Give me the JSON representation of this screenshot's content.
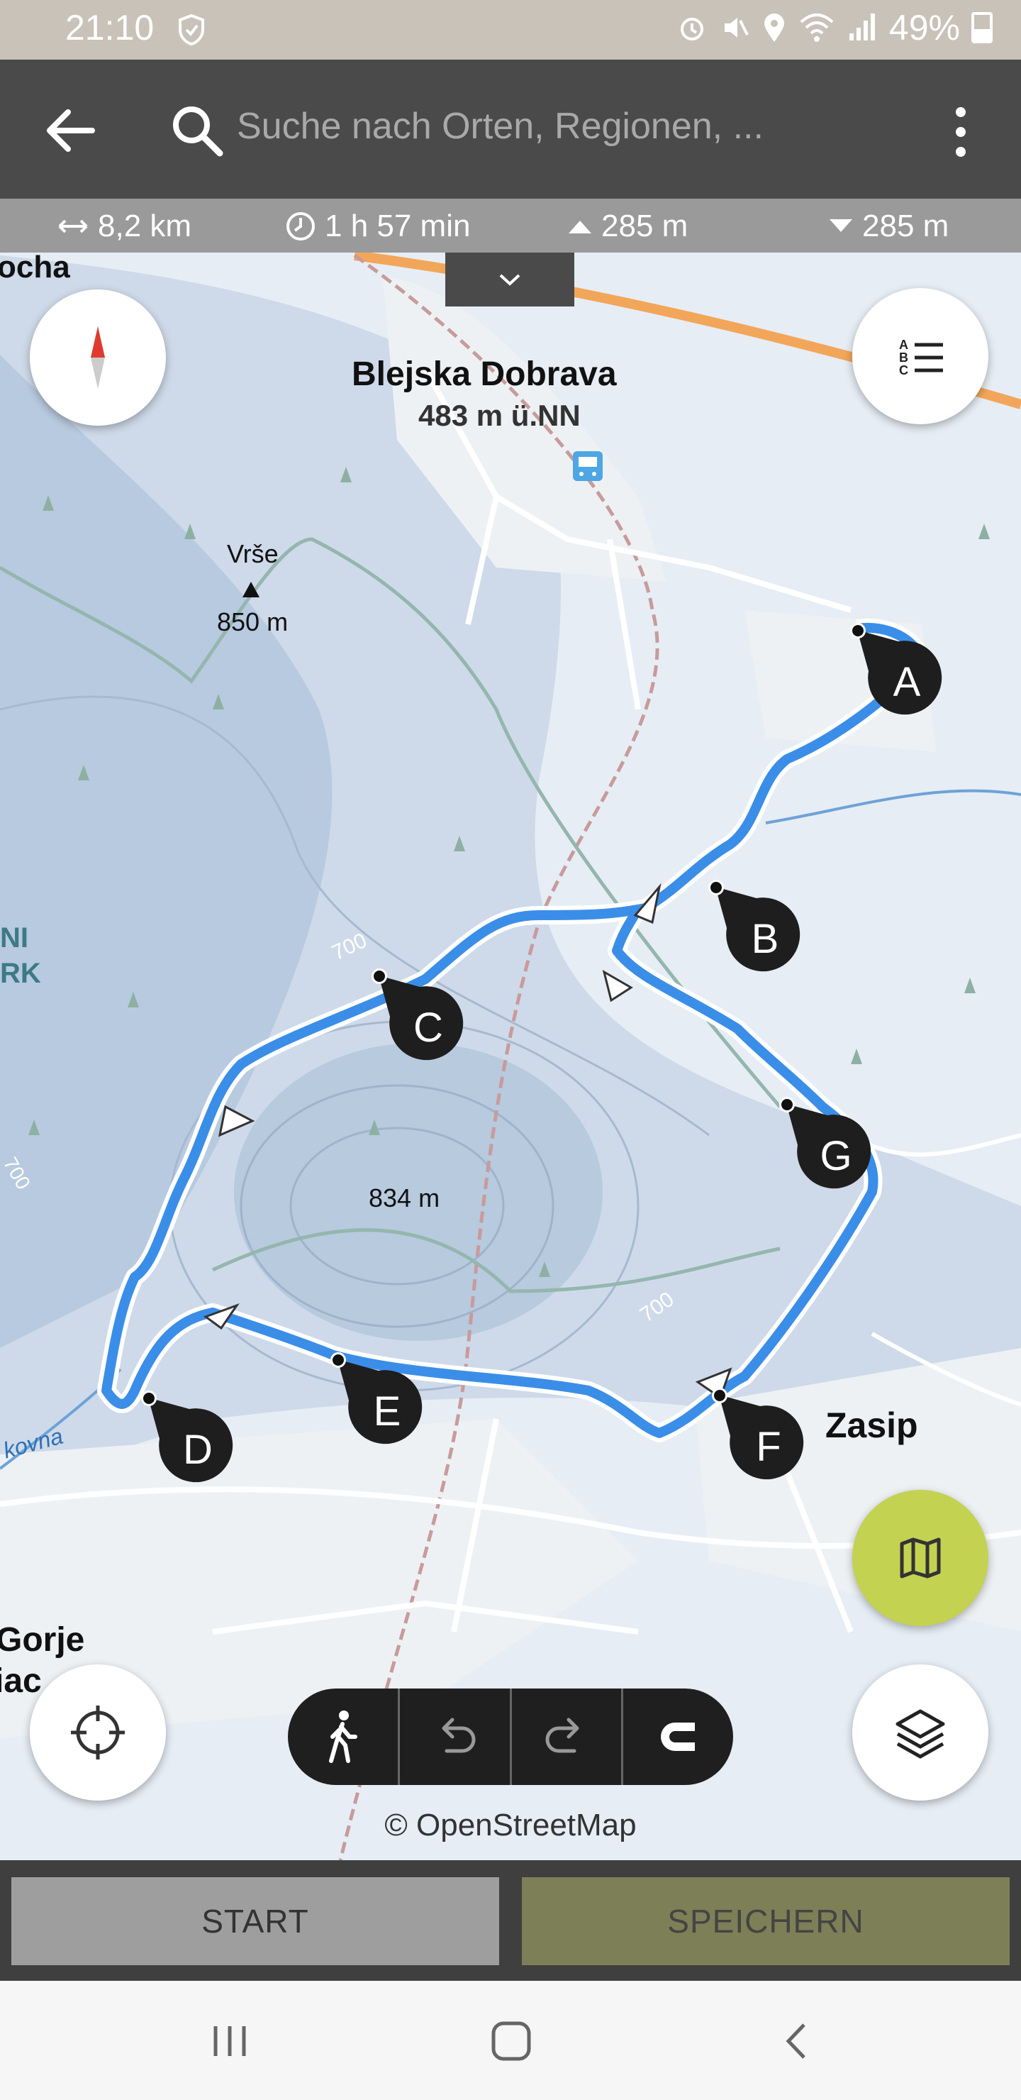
{
  "status_bar": {
    "time": "21:10",
    "battery": "49%"
  },
  "search": {
    "placeholder": "Suche nach Orten, Regionen, ..."
  },
  "stats": {
    "distance": "8,2 km",
    "duration": "1 h 57 min",
    "ascent": "285 m",
    "descent": "285 m"
  },
  "map": {
    "places": [
      {
        "name": "Blejska Dobrava",
        "sub": "483 m ü.NN"
      },
      {
        "name": "Vrše",
        "sub": "850 m"
      },
      {
        "name": "Zasip"
      }
    ],
    "peak_834": "834 m",
    "edge_labels": [
      "ocha",
      "NI",
      "RK",
      "Gorje",
      "iac",
      "kovna"
    ],
    "contour_labels": [
      "700",
      "700",
      "700"
    ],
    "waypoints": [
      "A",
      "B",
      "C",
      "D",
      "E",
      "F",
      "G"
    ],
    "route_color": "#3b8ee8",
    "attribution": "© OpenStreetMap"
  },
  "buttons": {
    "start": "START",
    "save": "SPEICHERN"
  },
  "colors": {
    "plan_fab": "#c3d251",
    "save_bg": "#7d7f57"
  }
}
